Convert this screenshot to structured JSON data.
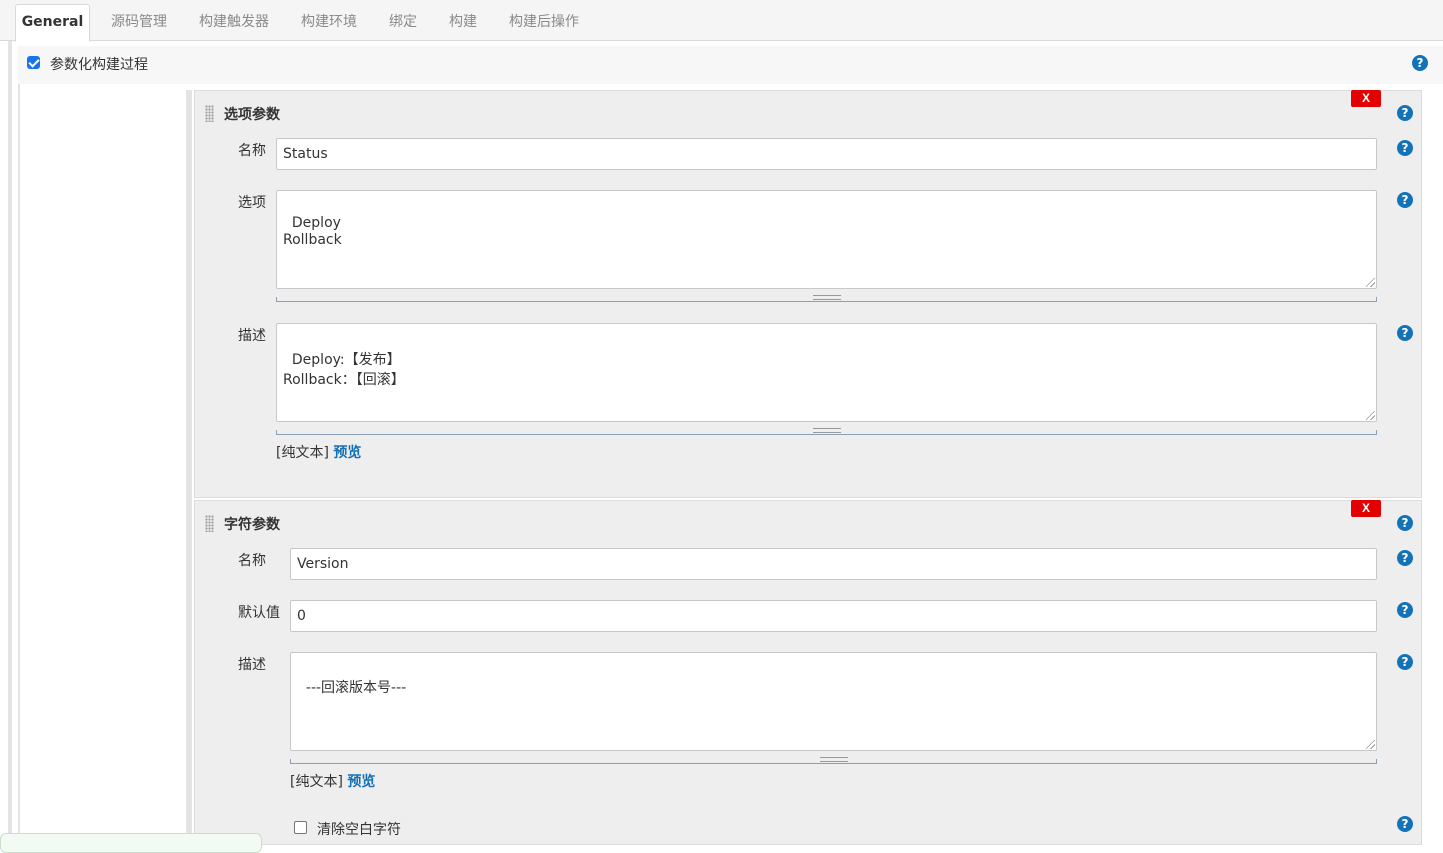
{
  "tabs": [
    "General",
    "源码管理",
    "构建触发器",
    "构建环境",
    "绑定",
    "构建",
    "构建后操作"
  ],
  "active_tab": "General",
  "parameterized": {
    "label": "参数化构建过程",
    "checked": true
  },
  "help_glyph": "?",
  "colors": {
    "accent": "#1473b6",
    "delete": "#e30000",
    "link": "#1470b4"
  },
  "choice_param": {
    "title": "选项参数",
    "delete_label": "X",
    "name_label": "名称",
    "name_value": "Status",
    "choices_label": "选项",
    "choices_value": "Deploy\nRollback",
    "desc_label": "描述",
    "desc_value": "Deploy:【发布】\nRollback：【回滚】",
    "format_text": "[纯文本]",
    "preview_link": "预览"
  },
  "string_param": {
    "title": "字符参数",
    "delete_label": "X",
    "name_label": "名称",
    "name_value": "Version",
    "default_label": "默认值",
    "default_value": "0",
    "desc_label": "描述",
    "desc_value": "---回滚版本号---",
    "format_text": "[纯文本]",
    "preview_link": "预览",
    "trim_label": "清除空白字符",
    "trim_checked": false
  }
}
